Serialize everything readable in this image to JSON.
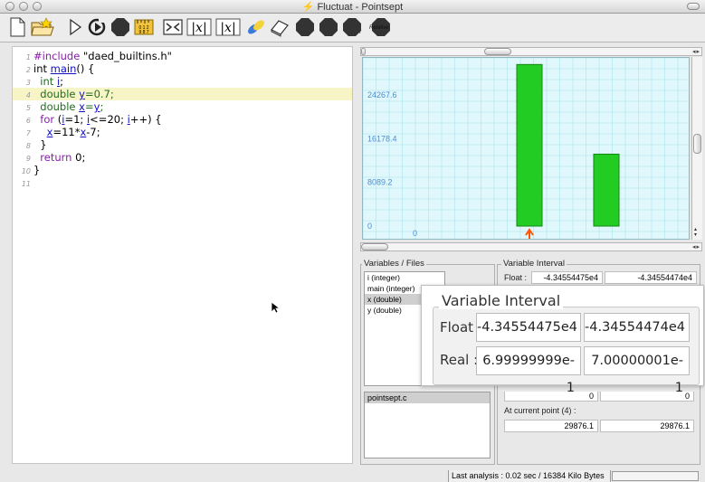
{
  "window": {
    "title": "Fluctuat - Pointsept"
  },
  "toolbar": {
    "buttons": [
      {
        "icon": "new-document-icon"
      },
      {
        "icon": "open-folder-icon"
      },
      {
        "icon": "run-icon"
      },
      {
        "icon": "step-icon"
      },
      {
        "icon": "stop-icon"
      },
      {
        "icon": "ruler-icon",
        "text": "0 1 2\n9 8 7"
      },
      {
        "icon": "bounds-icon"
      },
      {
        "icon": "var-x-icon",
        "text": "|x|"
      },
      {
        "icon": "var-x-icon",
        "text": "|x|"
      },
      {
        "icon": "pills-icon"
      },
      {
        "icon": "eraser-icon"
      },
      {
        "icon": "stop-icon"
      },
      {
        "icon": "stop-icon"
      },
      {
        "icon": "stop-icon",
        "text": "r"
      },
      {
        "icon": "stop-icon",
        "text": "Relative"
      }
    ]
  },
  "editor": {
    "lines": [
      {
        "num": "1",
        "parts": [
          {
            "t": "#include ",
            "c": "pp"
          },
          {
            "t": "\"daed_builtins.h\"",
            "c": "plain"
          }
        ]
      },
      {
        "num": "2",
        "parts": [
          {
            "t": "int ",
            "c": "plain"
          },
          {
            "t": "main",
            "c": "vr"
          },
          {
            "t": "() {",
            "c": "plain"
          }
        ]
      },
      {
        "num": "3",
        "parts": [
          {
            "t": "  int ",
            "c": "ty"
          },
          {
            "t": "i",
            "c": "vr"
          },
          {
            "t": ";",
            "c": "plain"
          }
        ]
      },
      {
        "num": "4",
        "parts": [
          {
            "t": "  double ",
            "c": "ty"
          },
          {
            "t": "y",
            "c": "vr"
          },
          {
            "t": "=0.7;",
            "c": "ty"
          }
        ],
        "highlight": true
      },
      {
        "num": "5",
        "parts": [
          {
            "t": "  double ",
            "c": "ty"
          },
          {
            "t": "x",
            "c": "vr"
          },
          {
            "t": "=",
            "c": "ty"
          },
          {
            "t": "y",
            "c": "vr"
          },
          {
            "t": ";",
            "c": "ty"
          }
        ]
      },
      {
        "num": "6",
        "parts": [
          {
            "t": "  for ",
            "c": "kw"
          },
          {
            "t": "(",
            "c": "plain"
          },
          {
            "t": "i",
            "c": "vr"
          },
          {
            "t": "=1; ",
            "c": "plain"
          },
          {
            "t": "i",
            "c": "vr"
          },
          {
            "t": "<=20; ",
            "c": "plain"
          },
          {
            "t": "i",
            "c": "vr"
          },
          {
            "t": "++) {",
            "c": "plain"
          }
        ]
      },
      {
        "num": "7",
        "parts": [
          {
            "t": "    ",
            "c": "plain"
          },
          {
            "t": "x",
            "c": "vr"
          },
          {
            "t": "=11*",
            "c": "plain"
          },
          {
            "t": "x",
            "c": "vr"
          },
          {
            "t": "-7;",
            "c": "plain"
          }
        ]
      },
      {
        "num": "8",
        "parts": [
          {
            "t": "  }",
            "c": "plain"
          }
        ]
      },
      {
        "num": "9",
        "parts": [
          {
            "t": "  return ",
            "c": "kw"
          },
          {
            "t": "0;",
            "c": "plain"
          }
        ]
      },
      {
        "num": "10",
        "parts": [
          {
            "t": "}",
            "c": "plain"
          }
        ]
      },
      {
        "num": "11",
        "parts": []
      }
    ]
  },
  "chart_data": {
    "type": "bar",
    "y_ticks": [
      "24267.6",
      "16178.4",
      "8089.2",
      "0"
    ],
    "x_ticks": [
      "0"
    ],
    "bars": [
      {
        "value": 29876.1
      },
      {
        "value": 13300
      }
    ],
    "colors": {
      "bar": "#22cc22",
      "background": "#e0f7fb",
      "grid": "#a8e3ee",
      "marker": "#ff5500",
      "tick": "#4f8fd0"
    }
  },
  "variables": {
    "label": "Variables / Files",
    "items": [
      "i (integer)",
      "main (integer)",
      "x (double)",
      "y (double)"
    ],
    "selected_index": 2,
    "files": [
      "pointsept.c"
    ]
  },
  "interval": {
    "label": "Variable Interval",
    "float_label": "Float :",
    "float_lo": "-4.34554475e4",
    "float_hi": "-4.34554474e4",
    "zero_lo": "0",
    "zero_hi": "0",
    "current_label": "At current point (4) :",
    "current_lo": "29876.1",
    "current_hi": "29876.1"
  },
  "popup": {
    "title": "Variable Interval",
    "float_label": "Float :",
    "float_lo": "-4.34554475e4",
    "float_hi": "-4.34554474e4",
    "real_label": "Real :",
    "real_lo": "6.99999999e-1",
    "real_hi": "7.00000001e-1"
  },
  "status": {
    "text": "Last analysis : 0.02 sec / 16384 Kilo Bytes"
  }
}
